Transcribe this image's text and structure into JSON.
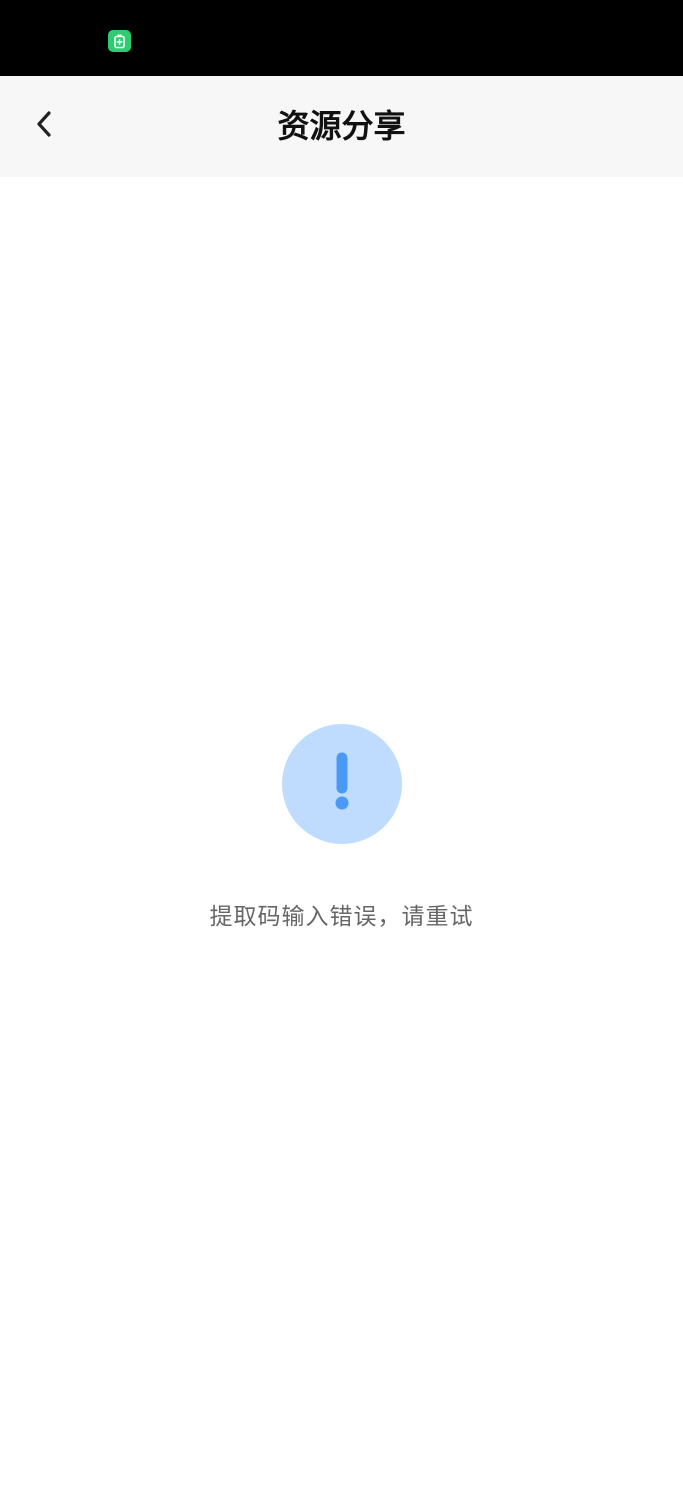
{
  "status_bar": {
    "app_icon": "battery-saver-icon",
    "app_icon_color": "#2ecc71"
  },
  "nav": {
    "title": "资源分享",
    "back_icon": "chevron-left-icon"
  },
  "error": {
    "icon": "exclamation-icon",
    "icon_bg_color": "#bfdcff",
    "icon_color": "#4a9af5",
    "message": "提取码输入错误，请重试"
  }
}
